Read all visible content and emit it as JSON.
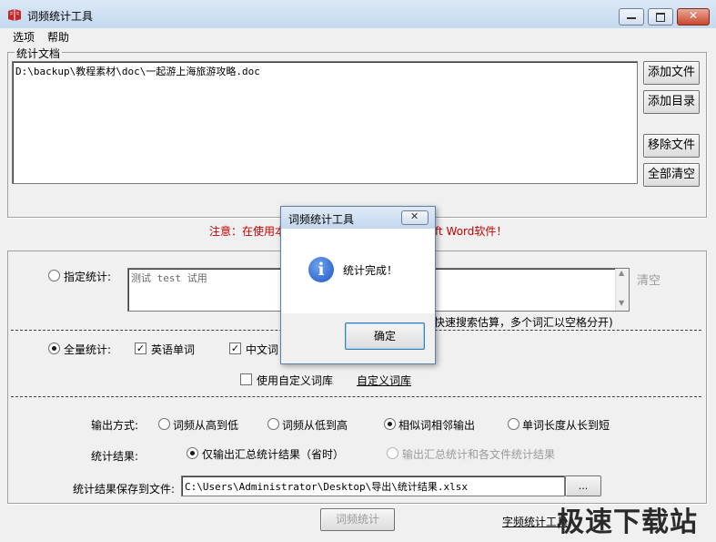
{
  "window": {
    "title": "词频统计工具"
  },
  "menu": [
    "选项",
    "帮助"
  ],
  "documents": {
    "group_label": "统计文档",
    "files": [
      "D:\\backup\\教程素材\\doc\\一起游上海旅游攻略.doc"
    ],
    "buttons": {
      "add_file": "添加文件",
      "add_dir": "添加目录",
      "remove_file": "移除文件",
      "clear_all": "全部清空"
    }
  },
  "notice": {
    "left": "注意：在使用本",
    "right": "ft Word软件！"
  },
  "stats": {
    "specified_label": "指定统计:",
    "specified_text": "测试 test 试用",
    "clear_link": "清空",
    "hint": "快速搜索估算，多个词汇以空格分开)",
    "full_label": "全量统计:",
    "english_words": "英语单词",
    "chinese_words": "中文词",
    "custom_dict_check": "使用自定义词库",
    "custom_dict_link": "自定义词库"
  },
  "output": {
    "mode_label": "输出方式:",
    "mode_options": [
      "词频从高到低",
      "词频从低到高",
      "相似词相邻输出",
      "单词长度从长到短"
    ],
    "mode_selected": 2,
    "result_label": "统计结果:",
    "result_options": [
      "仅输出汇总统计结果（省时）",
      "输出汇总统计和各文件统计结果"
    ],
    "result_selected": 0,
    "save_label": "统计结果保存到文件:",
    "save_path": "C:\\Users\\Administrator\\Desktop\\导出\\统计结果.xlsx",
    "browse": "...",
    "run_button": "词频统计",
    "char_link": "字频统计工具"
  },
  "dialog": {
    "title": "词频统计工具",
    "message": "统计完成！",
    "ok": "确定"
  },
  "watermark": "极速下载站",
  "colors": {
    "notice": "#c00000",
    "title_bg": "#c5d9ef"
  }
}
